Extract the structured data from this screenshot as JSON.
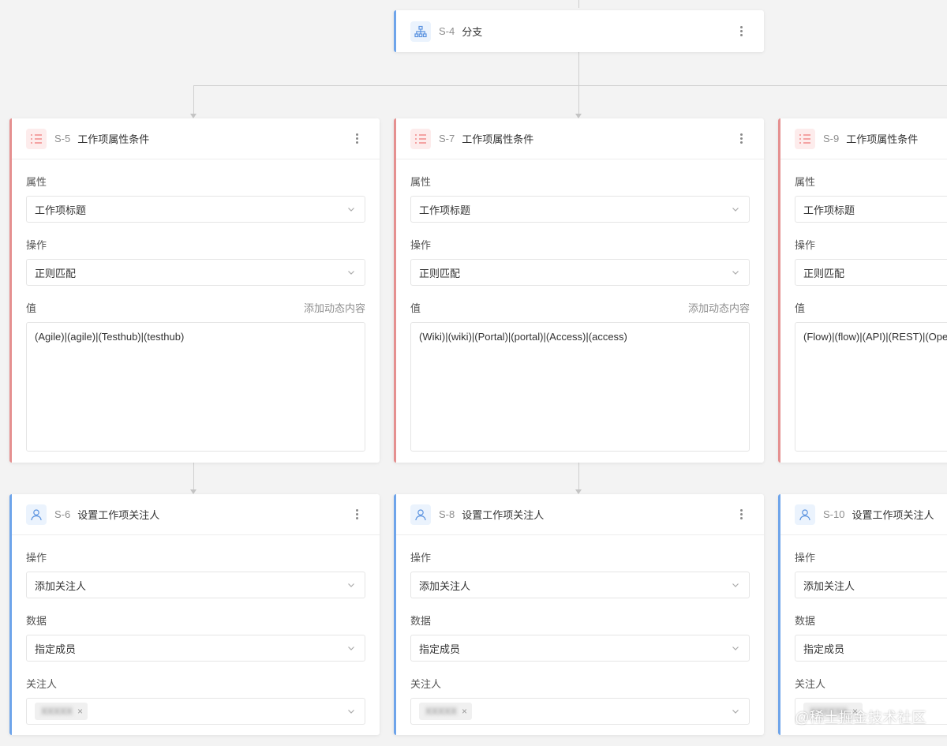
{
  "branch": {
    "code": "S-4",
    "title": "分支",
    "icon": "branch-icon"
  },
  "conditions": [
    {
      "code": "S-5",
      "title": "工作项属性条件",
      "icon": "list-icon",
      "attr_label": "属性",
      "attr_value": "工作项标题",
      "op_label": "操作",
      "op_value": "正则匹配",
      "value_label": "值",
      "dynamic_label": "添加动态内容",
      "value_text": "(Agile)|(agile)|(Testhub)|(testhub)"
    },
    {
      "code": "S-7",
      "title": "工作项属性条件",
      "icon": "list-icon",
      "attr_label": "属性",
      "attr_value": "工作项标题",
      "op_label": "操作",
      "op_value": "正则匹配",
      "value_label": "值",
      "dynamic_label": "添加动态内容",
      "value_text": "(Wiki)|(wiki)|(Portal)|(portal)|(Access)|(access)"
    },
    {
      "code": "S-9",
      "title": "工作项属性条件",
      "icon": "list-icon",
      "attr_label": "属性",
      "attr_value": "工作项标题",
      "op_label": "操作",
      "op_value": "正则匹配",
      "value_label": "值",
      "dynamic_label": "",
      "value_text": "(Flow)|(flow)|(API)|(REST)|(Ope"
    }
  ],
  "actions": [
    {
      "code": "S-6",
      "title": "设置工作项关注人",
      "icon": "user-icon",
      "op_label": "操作",
      "op_value": "添加关注人",
      "data_label": "数据",
      "data_value": "指定成员",
      "watcher_label": "关注人",
      "tag_name": "XXXXX",
      "tag_close": "×"
    },
    {
      "code": "S-8",
      "title": "设置工作项关注人",
      "icon": "user-icon",
      "op_label": "操作",
      "op_value": "添加关注人",
      "data_label": "数据",
      "data_value": "指定成员",
      "watcher_label": "关注人",
      "tag_name": "XXXXX",
      "tag_close": "×"
    },
    {
      "code": "S-10",
      "title": "设置工作项关注人",
      "icon": "user-icon",
      "op_label": "操作",
      "op_value": "添加关注人",
      "data_label": "数据",
      "data_value": "指定成员",
      "watcher_label": "关注人",
      "tag_name": "XXXXXX",
      "tag_close": "×"
    }
  ],
  "watermark": "@稀土掘金技术社区",
  "colors": {
    "accent_blue": "#6ea4ea",
    "accent_red": "#e59090",
    "background": "#f3f3f3"
  }
}
